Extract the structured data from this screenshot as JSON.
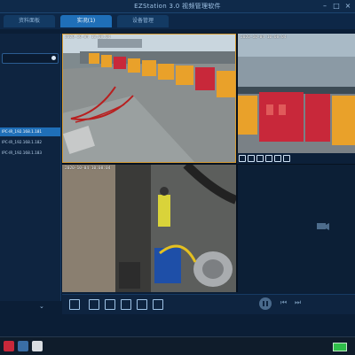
{
  "window": {
    "title": "EZStation 3.0 视频管理软件",
    "controls": [
      "–",
      "□",
      "×"
    ]
  },
  "tabs": [
    {
      "label": "资料面板",
      "active": false
    },
    {
      "label": "实况(1)",
      "active": true
    },
    {
      "label": "设备管理",
      "active": false
    }
  ],
  "device_tree": [
    {
      "label": "IPC-IR_192.168.1.181",
      "selected": true
    },
    {
      "label": "IPC-IR_192.168.1.182",
      "selected": false
    },
    {
      "label": "IPC-IR_192.168.1.183",
      "selected": false
    }
  ],
  "cameras": [
    {
      "timestamp": "2020-10-04 10:08:04",
      "scene": "construction-site-barriers",
      "selected": true
    },
    {
      "timestamp": "2020-10-04 10:08:04",
      "scene": "waterfront-barriers",
      "selected": false
    },
    {
      "timestamp": "2020-10-04 10:08:04",
      "scene": "shaft-interior-worker",
      "selected": false
    },
    {
      "timestamp": "",
      "scene": "empty",
      "selected": false
    }
  ],
  "colors": {
    "accent": "#1f6fb8",
    "selection_border": "#d39a33",
    "background": "#0b1e36"
  }
}
